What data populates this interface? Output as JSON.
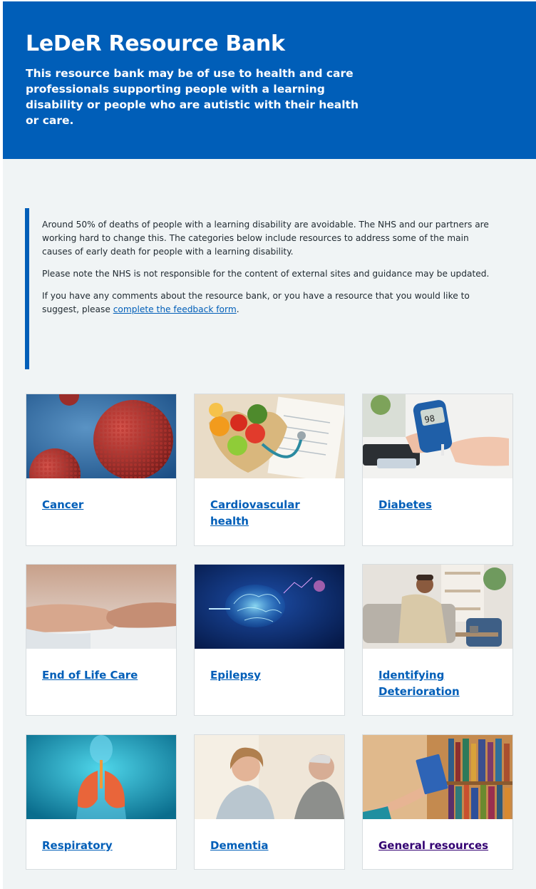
{
  "hero": {
    "title": "LeDeR Resource Bank",
    "description": "This resource bank may be of use to health and care professionals supporting people with a learning disability or people who are autistic with their health or care."
  },
  "intro": {
    "paragraph_1": "Around 50% of deaths of people with a learning disability are avoidable. The NHS and our partners are working hard to change this. The categories below include resources to address some of the main causes of early death for people with a learning disability.",
    "paragraph_2": "Please note the NHS is not responsible for the content of external sites and guidance may be updated.",
    "paragraph_3_prefix": "If you have any comments about the resource bank, or you have a resource that you would like to suggest, please ",
    "feedback_link": "complete the feedback form",
    "paragraph_3_suffix": "."
  },
  "cards": [
    {
      "title": "Cancer",
      "image": "cancer-cell-image"
    },
    {
      "title": "Cardiovascular health",
      "image": "heart-fruit-stethoscope-image"
    },
    {
      "title": "Diabetes",
      "image": "glucose-meter-image"
    },
    {
      "title": "End of Life Care",
      "image": "holding-hands-image"
    },
    {
      "title": "Epilepsy",
      "image": "glowing-brain-image"
    },
    {
      "title": "Identifying Deterioration",
      "image": "unwell-man-on-sofa-image"
    },
    {
      "title": "Respiratory",
      "image": "lungs-xray-image"
    },
    {
      "title": "Dementia",
      "image": "carer-with-elderly-man-image"
    },
    {
      "title": "General resources",
      "image": "bookshelf-image"
    }
  ],
  "colors": {
    "nhs_blue": "#005eb8",
    "background": "#f0f4f5",
    "link_visited": "#330072"
  }
}
